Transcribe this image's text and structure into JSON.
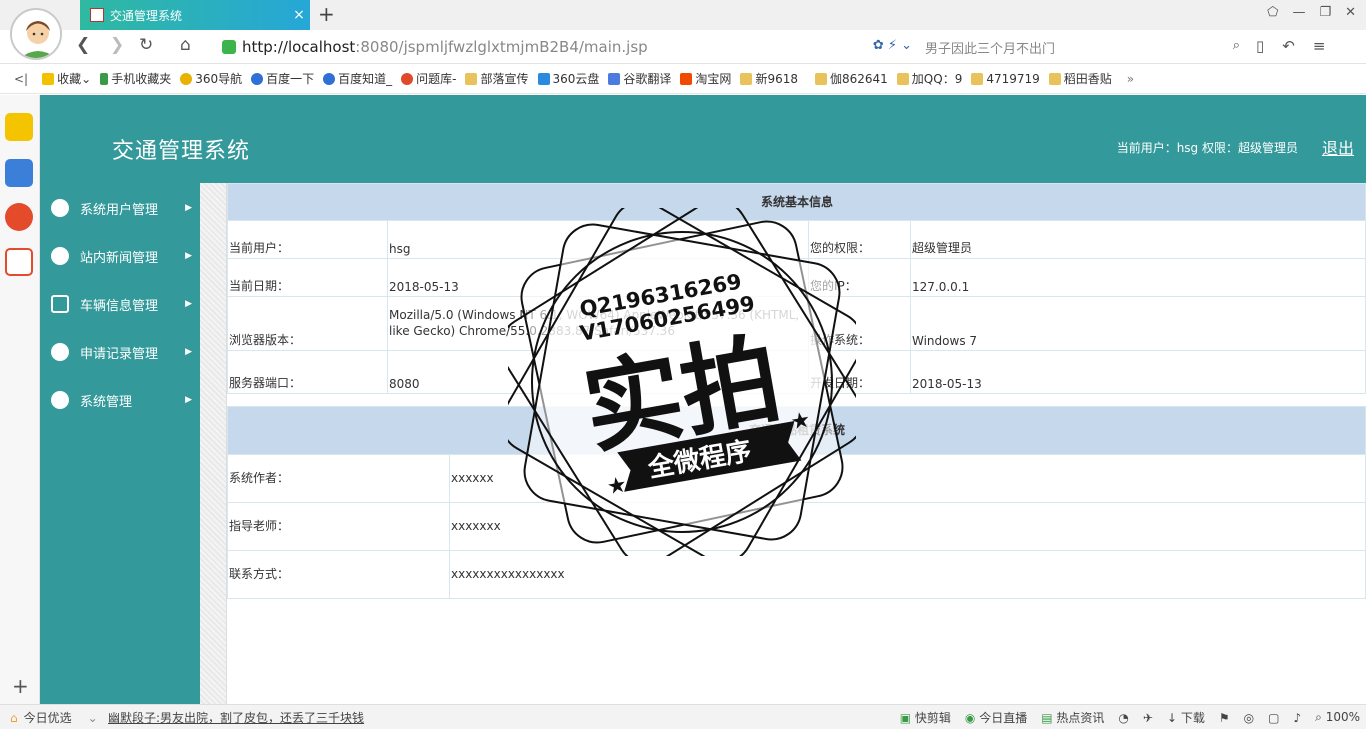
{
  "browser": {
    "tab_title": "交通管理系统",
    "tab_close": "×",
    "new_tab": "+",
    "url_host": "http://localhost",
    "url_path": ":8080/jspmljfwzlglxtmjmB2B4/main.jsp",
    "search_placeholder": "男子因此三个月不出门",
    "bookmarks": [
      {
        "label": "收藏",
        "icon": "star-icon"
      },
      {
        "label": "手机收藏夹",
        "icon": "phone-icon"
      },
      {
        "label": "360导航",
        "icon": "nav-icon"
      },
      {
        "label": "百度一下",
        "icon": "baidu-icon"
      },
      {
        "label": "百度知道_",
        "icon": "baidu-icon"
      },
      {
        "label": "问题库-",
        "icon": "site-icon"
      },
      {
        "label": "部落宣传",
        "icon": "folder-icon"
      },
      {
        "label": "360云盘",
        "icon": "cloud-icon"
      },
      {
        "label": "谷歌翻译",
        "icon": "translate-icon"
      },
      {
        "label": "淘宝网",
        "icon": "taobao-icon"
      },
      {
        "label": "新9618",
        "icon": "folder-icon"
      },
      {
        "label": "伽862641",
        "icon": "folder-icon"
      },
      {
        "label": "加QQ：9",
        "icon": "folder-icon"
      },
      {
        "label": "4719719",
        "icon": "folder-icon"
      },
      {
        "label": "稻田香贴",
        "icon": "folder-icon"
      }
    ],
    "bookmarks_more": "»"
  },
  "app": {
    "title": "交通管理系统",
    "user_label": "当前用户：hsg  权限：超级管理员",
    "logout": "退出"
  },
  "menu": [
    {
      "label": "系统用户管理",
      "icon": "monitor-icon"
    },
    {
      "label": "站内新闻管理",
      "icon": "user-news-icon"
    },
    {
      "label": "车辆信息管理",
      "icon": "vehicle-icon"
    },
    {
      "label": "申请记录管理",
      "icon": "app-icon"
    },
    {
      "label": "系统管理",
      "icon": "chart-icon"
    }
  ],
  "sysinfo": {
    "header": "系统基本信息",
    "rows": [
      {
        "k1": "当前用户：",
        "v1": "hsg",
        "k2": "您的权限：",
        "v2": "超级管理员"
      },
      {
        "k1": "当前日期：",
        "v1": "2018-05-13",
        "k2": "您的IP：",
        "v2": "127.0.0.1"
      },
      {
        "k1": "浏览器版本：",
        "v1": "Mozilla/5.0 (Windows NT 6.1; WOW64) AppleWebKit/537.36 (KHTML, like Gecko) Chrome/55.0.2883.87 Safari/537.36",
        "k2": "操作系统：",
        "v2": "Windows 7"
      },
      {
        "k1": "服务器端口：",
        "v1": "8080",
        "k2": "开发日期：",
        "v2": "2018-05-13"
      }
    ]
  },
  "about": {
    "header": "交通用品租赁系统",
    "rows": [
      {
        "k": "系统作者：",
        "v": "xxxxxx"
      },
      {
        "k": "指导老师：",
        "v": "xxxxxxx"
      },
      {
        "k": "联系方式：",
        "v": "xxxxxxxxxxxxxxxx"
      }
    ]
  },
  "stamp": {
    "line1": "Q2196316269",
    "line2": "V17060256499",
    "big": "实拍",
    "banner": "全微程序"
  },
  "statusbar": {
    "today": "今日优选",
    "news": "幽默段子:男友出院，割了皮包，还丢了三千块钱",
    "items": [
      "快剪辑",
      "今日直播",
      "热点资讯",
      "下载"
    ],
    "zoom": "100%"
  }
}
